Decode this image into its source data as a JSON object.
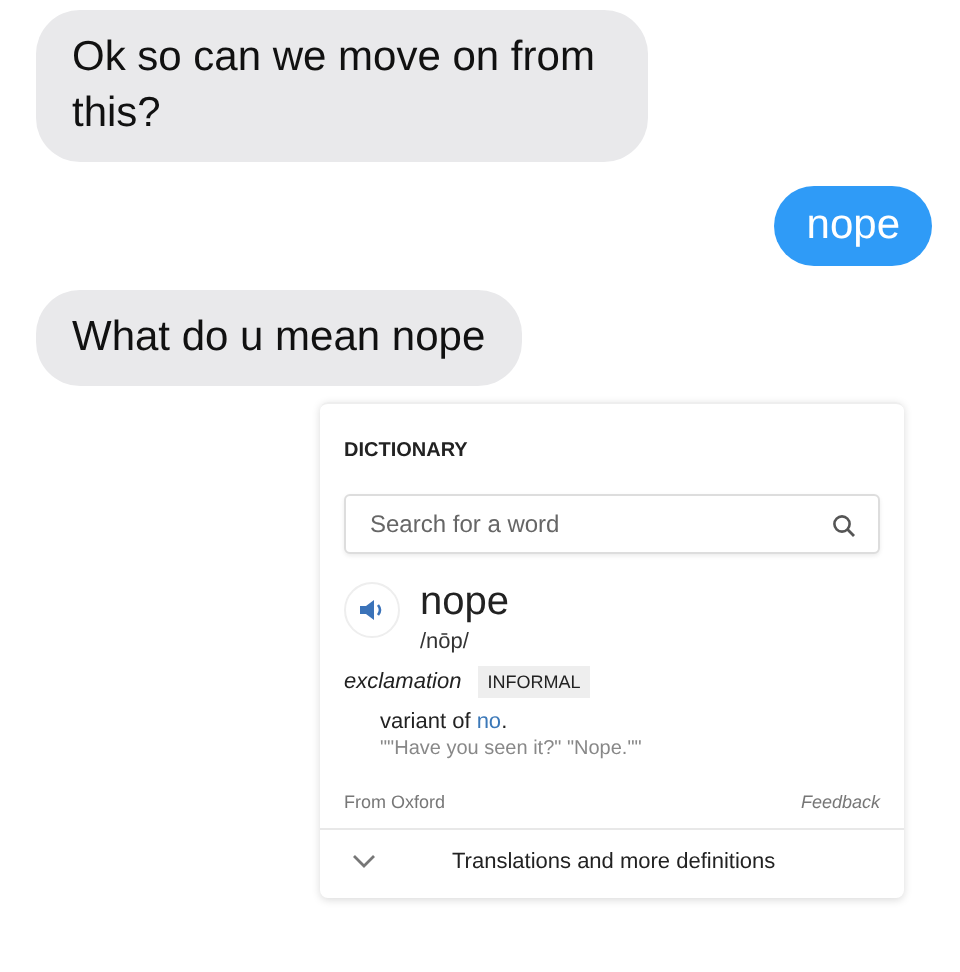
{
  "messages": [
    {
      "kind": "received",
      "text": "Ok so can we move on from this?"
    },
    {
      "kind": "sent",
      "text": "nope"
    },
    {
      "kind": "received",
      "text": "What do u mean nope"
    }
  ],
  "dictionary": {
    "heading": "DICTIONARY",
    "search": {
      "placeholder": "Search for a word"
    },
    "word": "nope",
    "pronunciation": "/nōp/",
    "part_of_speech": "exclamation",
    "register": "INFORMAL",
    "definition": {
      "before": "variant of ",
      "link": "no",
      "after": "."
    },
    "example": "\"\"Have you seen it?\" \"Nope.\"\"",
    "source": "From Oxford",
    "feedback": "Feedback",
    "more": "Translations and more definitions"
  }
}
